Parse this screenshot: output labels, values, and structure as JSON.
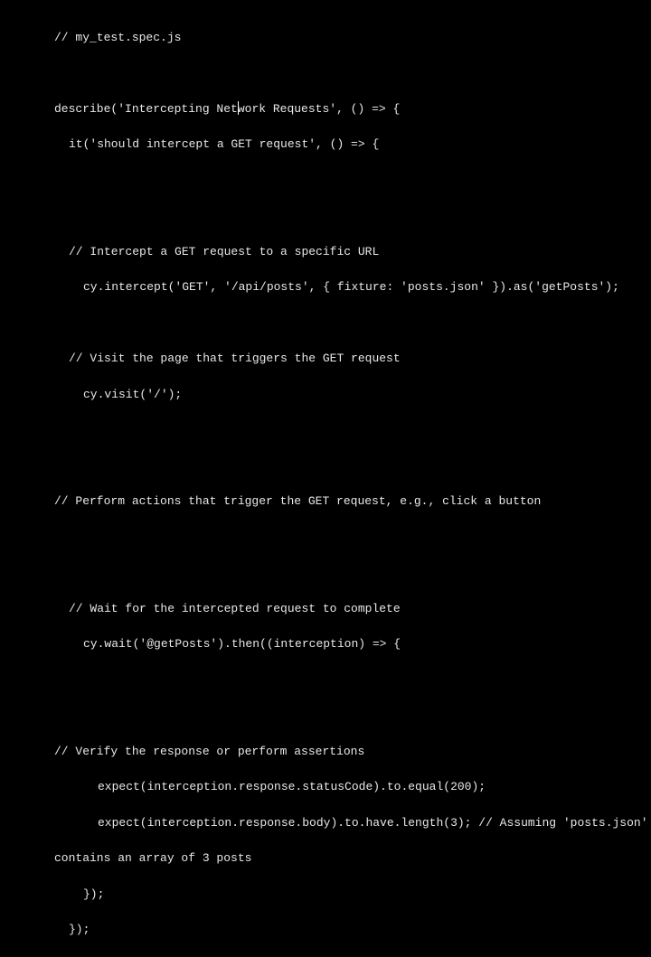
{
  "code": {
    "line1": "// my_test.spec.js",
    "line2": "",
    "line3_a": "describe('Intercepting Net",
    "line3_b": "work Requests', () => {",
    "line4": "it('should intercept a GET request', () => {",
    "line5": "",
    "line6": "",
    "line7": "// Intercept a GET request to a specific URL",
    "line8": "cy.intercept('GET', '/api/posts', { fixture: 'posts.json' }).as('getPosts');",
    "line9": "",
    "line10": "// Visit the page that triggers the GET request",
    "line11": "cy.visit('/');",
    "line12": "",
    "line13": "",
    "line14": "// Perform actions that trigger the GET request, e.g., click a button",
    "line15": "",
    "line16": "",
    "line17": "// Wait for the intercepted request to complete",
    "line18": "cy.wait('@getPosts').then((interception) => {",
    "line19": "",
    "line20": "",
    "line21": "// Verify the response or perform assertions",
    "line22": "expect(interception.response.statusCode).to.equal(200);",
    "line23": "expect(interception.response.body).to.have.length(3); // Assuming 'posts.json'",
    "line24": "contains an array of 3 posts",
    "line25": "});",
    "line26": "});"
  }
}
